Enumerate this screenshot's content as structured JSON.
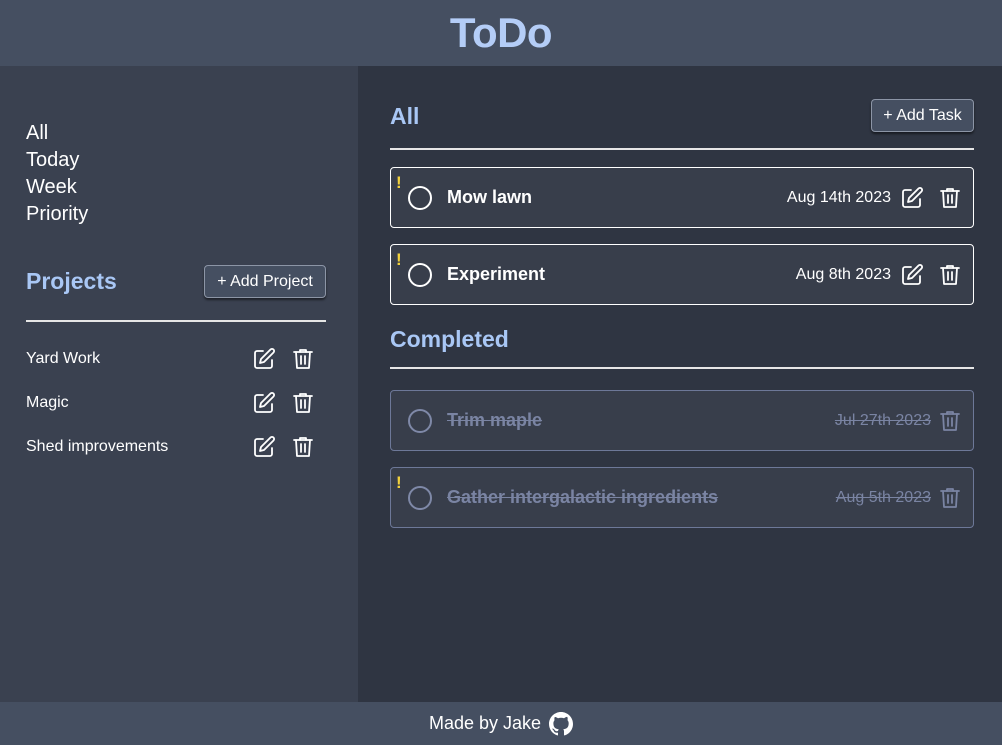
{
  "header": {
    "title": "ToDo"
  },
  "sidebar": {
    "nav": [
      "All",
      "Today",
      "Week",
      "Priority"
    ],
    "projects_title": "Projects",
    "add_project_label": "+ Add Project",
    "projects": [
      {
        "name": "Yard Work"
      },
      {
        "name": "Magic"
      },
      {
        "name": "Shed improvements"
      }
    ]
  },
  "main": {
    "title": "All",
    "add_task_label": "+ Add Task",
    "tasks": [
      {
        "title": "Mow lawn",
        "date": "Aug 14th 2023",
        "priority_mark": "!"
      },
      {
        "title": "Experiment",
        "date": "Aug 8th 2023",
        "priority_mark": "!"
      }
    ],
    "completed_title": "Completed",
    "completed": [
      {
        "title": "Trim maple",
        "date": "Jul 27th 2023",
        "priority_mark": ""
      },
      {
        "title": "Gather intergalactic ingredients",
        "date": "Aug 5th 2023",
        "priority_mark": "!"
      }
    ]
  },
  "footer": {
    "text": "Made by Jake",
    "icon": "github-icon"
  },
  "colors": {
    "header_bg": "#454f61",
    "sidebar_bg": "#3a4150",
    "main_bg": "#2f3542",
    "accent": "#a9c7f5",
    "priority": "#f3d23c",
    "completed_text": "#7a84a3"
  }
}
